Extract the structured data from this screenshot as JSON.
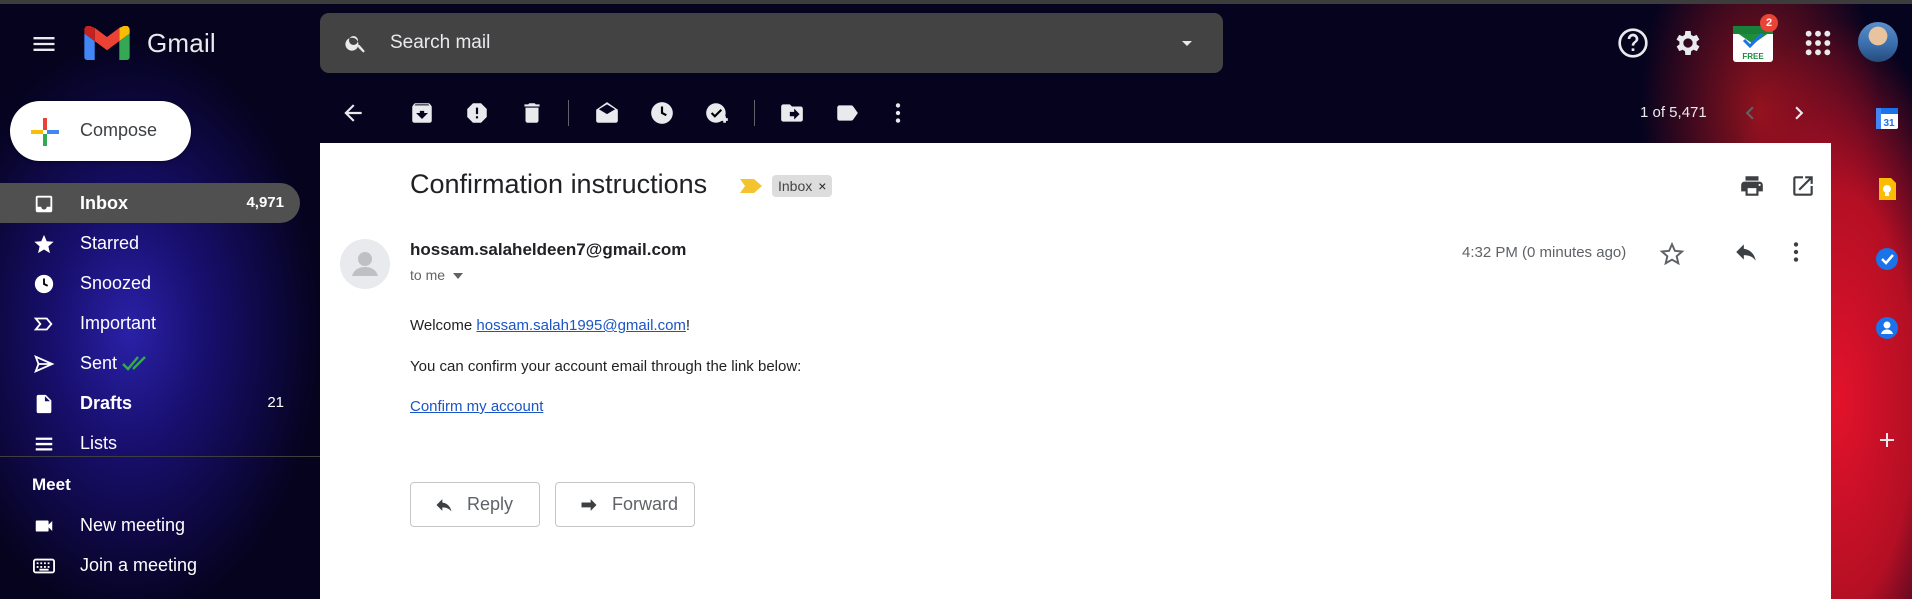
{
  "header": {
    "brand": "Gmail",
    "search_placeholder": "Search mail",
    "extension_badge_count": "2",
    "extension_badge_label": "FREE"
  },
  "sidebar": {
    "compose_label": "Compose",
    "items": [
      {
        "label": "Inbox",
        "count": "4,971",
        "active": true,
        "icon": "inbox-icon"
      },
      {
        "label": "Starred",
        "count": "",
        "icon": "star-icon"
      },
      {
        "label": "Snoozed",
        "count": "",
        "icon": "clock-icon"
      },
      {
        "label": "Important",
        "count": "",
        "icon": "important-icon"
      },
      {
        "label": "Sent",
        "count": "",
        "icon": "send-icon"
      },
      {
        "label": "Drafts",
        "count": "21",
        "icon": "draft-icon"
      },
      {
        "label": "Lists",
        "count": "",
        "icon": "list-icon"
      }
    ],
    "meet": {
      "title": "Meet",
      "items": [
        {
          "label": "New meeting",
          "icon": "video-icon"
        },
        {
          "label": "Join a meeting",
          "icon": "keyboard-icon"
        }
      ]
    }
  },
  "toolbar": {
    "pager_text": "1 of 5,471"
  },
  "email": {
    "subject": "Confirmation instructions",
    "label": "Inbox",
    "label_close": "×",
    "sender": "hossam.salaheldeen7@gmail.com",
    "to": "to me",
    "time": "4:32 PM (0 minutes ago)",
    "welcome_prefix": "Welcome ",
    "welcome_link": "hossam.salah1995@gmail.com",
    "welcome_suffix": "!",
    "line2": "You can confirm your account email through the link below:",
    "confirm_link": "Confirm my account",
    "reply_label": "Reply",
    "forward_label": "Forward"
  },
  "colors": {
    "accent_red": "#ea4335",
    "link_blue": "#1a55c6",
    "active_nav": "#505050",
    "important_yellow": "#f4c430"
  }
}
